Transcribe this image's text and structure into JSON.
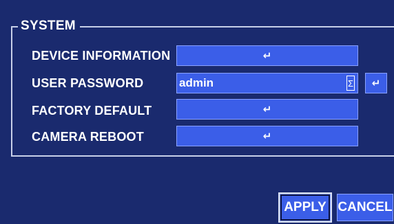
{
  "section": {
    "title": "SYSTEM"
  },
  "rows": {
    "device_information": {
      "label": "DEVICE INFORMATION",
      "action_icon": "enter-icon"
    },
    "user_password": {
      "label": "USER PASSWORD",
      "value": "admin",
      "keyboard_icon": "virtual-keyboard-icon",
      "action_icon": "enter-icon"
    },
    "factory_default": {
      "label": "FACTORY DEFAULT",
      "action_icon": "enter-icon"
    },
    "camera_reboot": {
      "label": "CAMERA REBOOT",
      "action_icon": "enter-icon"
    }
  },
  "buttons": {
    "apply_label": "APPLY",
    "cancel_label": "CANCEL"
  },
  "colors": {
    "background": "#1a2a6e",
    "field": "#3b5ee8",
    "text": "#ffffff",
    "frame": "#c8d0e8"
  }
}
